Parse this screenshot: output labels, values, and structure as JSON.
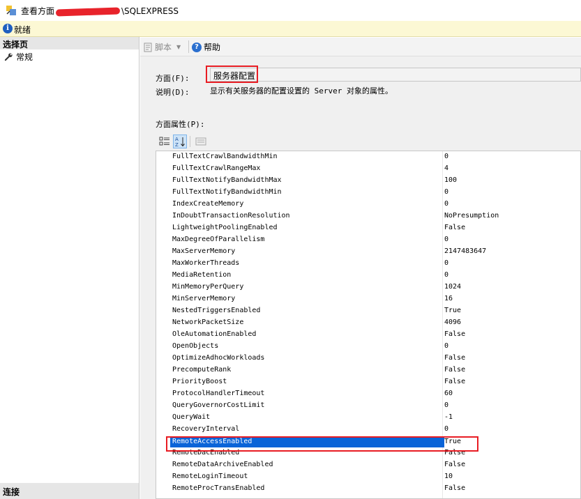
{
  "window": {
    "title_prefix": "查看方面",
    "title_suffix": "\\SQLEXPRESS"
  },
  "status": {
    "text": "就绪"
  },
  "sidebar": {
    "header": "选择页",
    "items": [
      {
        "label": "常规",
        "icon": "wrench-icon"
      }
    ],
    "footer": "连接"
  },
  "toolbar": {
    "script_label": "脚本",
    "help_label": "帮助"
  },
  "form": {
    "facet_label": "方面(F):",
    "facet_value": "服务器配置",
    "description_label": "说明(D):",
    "description_text": "显示有关服务器的配置设置的 Server 对象的属性。",
    "properties_label": "方面属性(P):"
  },
  "properties": [
    {
      "name": "FullTextCrawlBandwidthMin",
      "value": "0"
    },
    {
      "name": "FullTextCrawlRangeMax",
      "value": "4"
    },
    {
      "name": "FullTextNotifyBandwidthMax",
      "value": "100"
    },
    {
      "name": "FullTextNotifyBandwidthMin",
      "value": "0"
    },
    {
      "name": "IndexCreateMemory",
      "value": "0"
    },
    {
      "name": "InDoubtTransactionResolution",
      "value": "NoPresumption"
    },
    {
      "name": "LightweightPoolingEnabled",
      "value": "False"
    },
    {
      "name": "MaxDegreeOfParallelism",
      "value": "0"
    },
    {
      "name": "MaxServerMemory",
      "value": "2147483647"
    },
    {
      "name": "MaxWorkerThreads",
      "value": "0"
    },
    {
      "name": "MediaRetention",
      "value": "0"
    },
    {
      "name": "MinMemoryPerQuery",
      "value": "1024"
    },
    {
      "name": "MinServerMemory",
      "value": "16"
    },
    {
      "name": "NestedTriggersEnabled",
      "value": "True"
    },
    {
      "name": "NetworkPacketSize",
      "value": "4096"
    },
    {
      "name": "OleAutomationEnabled",
      "value": "False"
    },
    {
      "name": "OpenObjects",
      "value": "0"
    },
    {
      "name": "OptimizeAdhocWorkloads",
      "value": "False"
    },
    {
      "name": "PrecomputeRank",
      "value": "False"
    },
    {
      "name": "PriorityBoost",
      "value": "False"
    },
    {
      "name": "ProtocolHandlerTimeout",
      "value": "60"
    },
    {
      "name": "QueryGovernorCostLimit",
      "value": "0"
    },
    {
      "name": "QueryWait",
      "value": "-1"
    },
    {
      "name": "RecoveryInterval",
      "value": "0"
    },
    {
      "name": "RemoteAccessEnabled",
      "value": "True",
      "selected": true
    },
    {
      "name": "RemoteDacEnabled",
      "value": "False"
    },
    {
      "name": "RemoteDataArchiveEnabled",
      "value": "False"
    },
    {
      "name": "RemoteLoginTimeout",
      "value": "10"
    },
    {
      "name": "RemoteProcTransEnabled",
      "value": "False"
    }
  ],
  "colors": {
    "selection": "#0a64d8",
    "highlight_box": "#e81c23",
    "status_bg": "#fcf8d4"
  }
}
